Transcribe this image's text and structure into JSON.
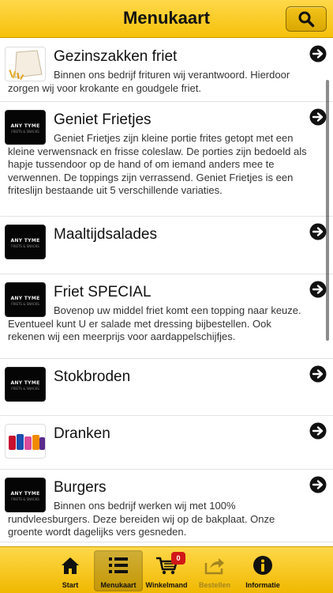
{
  "header": {
    "title": "Menukaart"
  },
  "brand_logo": {
    "text": "ANY TYME",
    "subtext": "FRIETS & SNACKS"
  },
  "menu": [
    {
      "title": "Gezinszakken friet",
      "description": "Binnen ons bedrijf frituren wij verantwoord. Hierdoor zorgen wij voor krokante en goudgele friet.",
      "thumb": "fries-bag"
    },
    {
      "title": "Geniet Frietjes",
      "description": "Geniet Frietjes zijn kleine portie frites getopt met een kleine verwensnack en frisse coleslaw. De porties zijn bedoeld als hapje tussendoor op de hand of om iemand anders mee te verwennen. De toppings zijn verrassend. Geniet Frietjes is een friteslijn bestaande uit 5 verschillende variaties.",
      "thumb": "logo"
    },
    {
      "title": "Maaltijdsalades",
      "description": "",
      "thumb": "logo"
    },
    {
      "title": "Friet SPECIAL",
      "description": "Bovenop uw middel friet komt een topping naar keuze. Eventueel kunt U er salade met dressing bijbestellen. Ook rekenen wij een meerprijs voor aardappelschijfjes.",
      "thumb": "logo"
    },
    {
      "title": "Stokbroden",
      "description": "",
      "thumb": "logo"
    },
    {
      "title": "Dranken",
      "description": "",
      "thumb": "drinks"
    },
    {
      "title": "Burgers",
      "description": "Binnen ons bedrijf werken wij met 100% rundvleesburgers. Deze bereiden wij op de bakplaat. Onze groente wordt dagelijks vers gesneden.",
      "thumb": "logo"
    }
  ],
  "tabbar": {
    "start": "Start",
    "menukaart": "Menukaart",
    "winkelmand": "Winkelmand",
    "cart_count": "0",
    "bestellen": "Bestellen",
    "informatie": "Informatie"
  },
  "colors": {
    "header": "#f6c10a",
    "tabbar": "#f0b800",
    "badge": "#d11818"
  }
}
